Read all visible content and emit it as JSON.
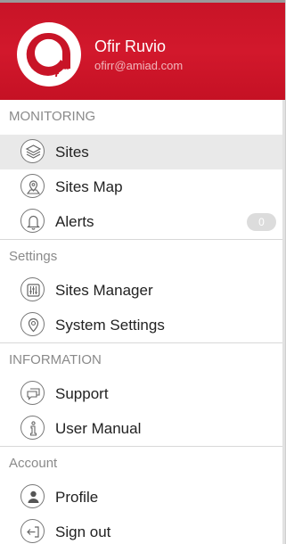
{
  "user": {
    "name": "Ofir Ruvio",
    "email": "ofirr@amiad.com"
  },
  "colors": {
    "header": "#c81427",
    "selected_bg": "#e9e9e9"
  },
  "sections": {
    "monitoring": "MONITORING",
    "settings": "Settings",
    "information": "INFORMATION",
    "account": "Account"
  },
  "menu": {
    "sites": {
      "label": "Sites",
      "icon": "layers-icon",
      "selected": true
    },
    "sites_map": {
      "label": "Sites Map",
      "icon": "map-pin-icon"
    },
    "alerts": {
      "label": "Alerts",
      "icon": "bell-icon",
      "badge": "0"
    },
    "sites_manager": {
      "label": "Sites Manager",
      "icon": "sliders-icon"
    },
    "system_settings": {
      "label": "System Settings",
      "icon": "location-pin-icon"
    },
    "support": {
      "label": "Support",
      "icon": "chat-bubbles-icon"
    },
    "user_manual": {
      "label": "User Manual",
      "icon": "info-icon"
    },
    "profile": {
      "label": "Profile",
      "icon": "person-icon"
    },
    "sign_out": {
      "label": "Sign out",
      "icon": "sign-out-icon"
    }
  }
}
